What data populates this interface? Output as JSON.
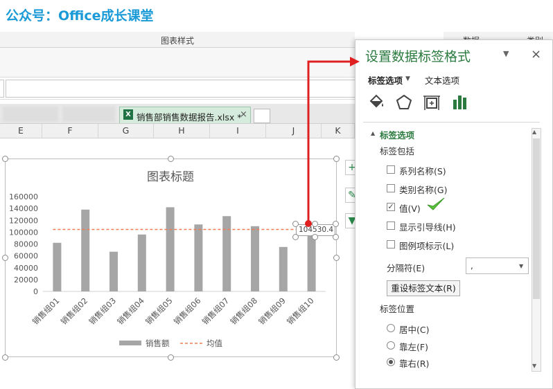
{
  "watermark": "公众号：Office成长课堂",
  "ribbon": {
    "group_label": "图表样式",
    "right_label_1": "数据",
    "right_label_2": "类别"
  },
  "file_tab": {
    "name": "销售部销售数据报告.xlsx *",
    "close": "×",
    "icon": "X"
  },
  "columns": [
    "E",
    "F",
    "G",
    "H",
    "I",
    "J",
    "K"
  ],
  "chart_data": {
    "type": "bar",
    "title": "图表标题",
    "categories": [
      "销售组01",
      "销售组02",
      "销售组03",
      "销售组04",
      "销售组05",
      "销售组06",
      "销售组07",
      "销售组08",
      "销售组09",
      "销售组10"
    ],
    "series": [
      {
        "name": "销售额",
        "type": "bar",
        "color": "#a6a6a6",
        "values": [
          82000,
          138000,
          67000,
          96000,
          142000,
          113000,
          127000,
          110000,
          75000,
          95000
        ]
      },
      {
        "name": "均值",
        "type": "line",
        "style": "dashed",
        "color": "#f07b50",
        "value": 104530.4
      }
    ],
    "y_ticks": [
      "0",
      "20000",
      "40000",
      "60000",
      "80000",
      "100000",
      "120000",
      "140000",
      "160000"
    ],
    "ylim": [
      0,
      160000
    ],
    "data_label": "104530.4",
    "legend_position": "bottom"
  },
  "pane": {
    "title": "设置数据标签格式",
    "dropdown_icon": "chevron-down-icon",
    "close": "×",
    "tabs": {
      "label_options": "标签选项",
      "text_options": "文本选项"
    },
    "section": "标签选项",
    "contains_label": "标签包括",
    "checkboxes": [
      {
        "label": "系列名称(S)",
        "checked": false
      },
      {
        "label": "类别名称(G)",
        "checked": false
      },
      {
        "label": "值(V)",
        "checked": true
      },
      {
        "label": "显示引导线(H)",
        "checked": false
      },
      {
        "label": "图例项标示(L)",
        "checked": false
      }
    ],
    "separator_label": "分隔符(E)",
    "separator_value": ",",
    "reset_button": "重设标签文本(R)",
    "position_label": "标签位置",
    "radios": [
      {
        "label": "居中(C)",
        "checked": false
      },
      {
        "label": "靠左(F)",
        "checked": false
      },
      {
        "label": "靠右(R)",
        "checked": true
      }
    ]
  },
  "colors": {
    "accent_green": "#2b7a3f",
    "arrow_red": "#e02020",
    "check_green": "#5cc33a"
  }
}
